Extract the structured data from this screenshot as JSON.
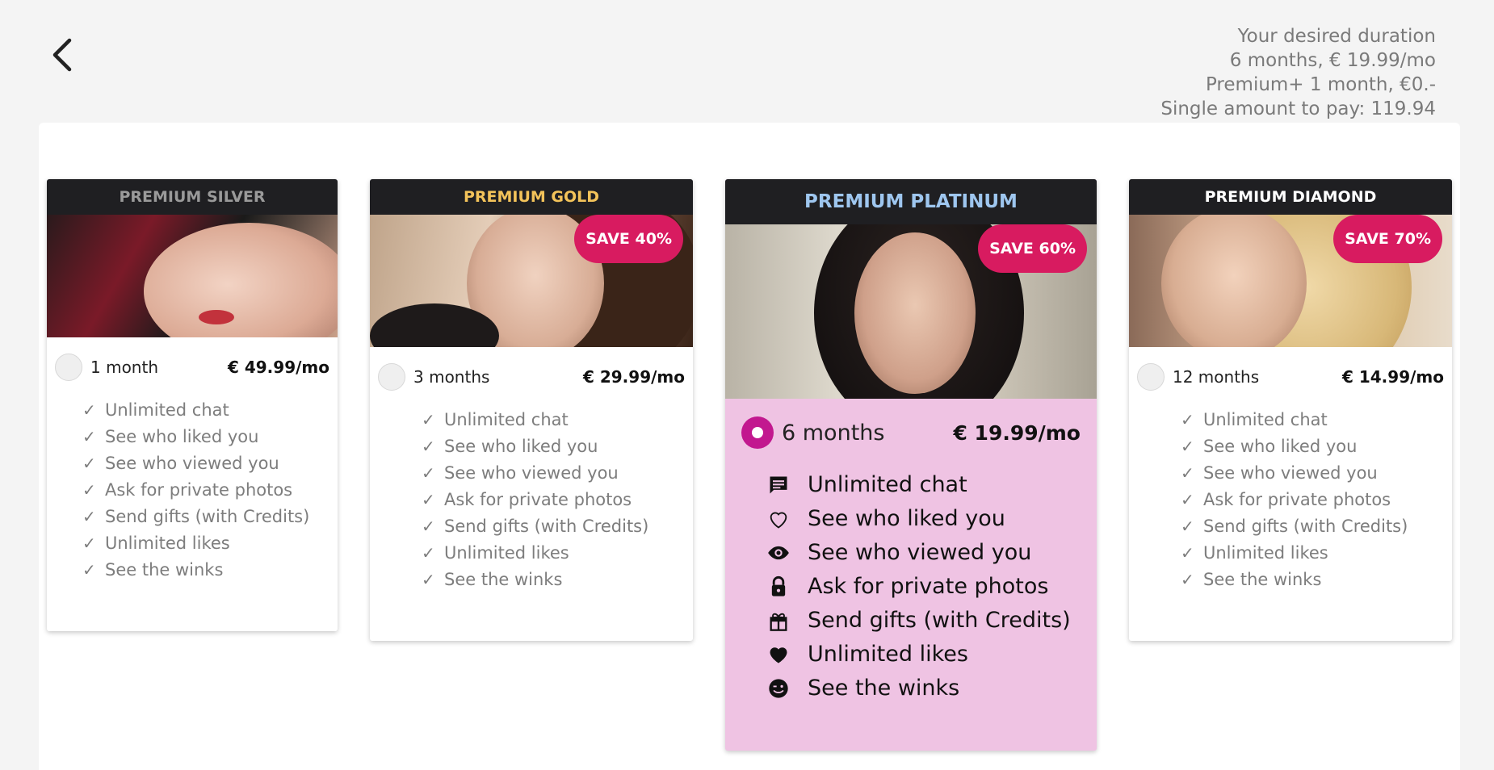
{
  "summary": {
    "line1": "Your desired duration",
    "line2": "6 months, € 19.99/mo",
    "line3": "Premium+ 1 month, €0.-",
    "line4": "Single amount to pay: 119.94"
  },
  "plans": [
    {
      "name": "PREMIUM SILVER",
      "header_color": "#9a9a9a",
      "duration": "1 month",
      "price": "€ 49.99/mo",
      "save": "",
      "selected": false
    },
    {
      "name": "PREMIUM GOLD",
      "header_color": "#f3c35a",
      "duration": "3 months",
      "price": "€ 29.99/mo",
      "save": "SAVE 40%",
      "selected": false
    },
    {
      "name": "PREMIUM PLATINUM",
      "header_color": "#9ec6ef",
      "duration": "6 months",
      "price": "€ 19.99/mo",
      "save": "SAVE 60%",
      "selected": true
    },
    {
      "name": "PREMIUM DIAMOND",
      "header_color": "#ffffff",
      "duration": "12 months",
      "price": "€ 14.99/mo",
      "save": "SAVE 70%",
      "selected": false
    }
  ],
  "features": [
    {
      "label": "Unlimited chat",
      "icon": "chat-icon"
    },
    {
      "label": "See who liked you",
      "icon": "heart-outline-icon"
    },
    {
      "label": "See who viewed you",
      "icon": "eye-icon"
    },
    {
      "label": "Ask for private photos",
      "icon": "lock-icon"
    },
    {
      "label": "Send gifts (with Credits)",
      "icon": "gift-icon"
    },
    {
      "label": "Unlimited likes",
      "icon": "heart-icon"
    },
    {
      "label": "See the winks",
      "icon": "wink-icon"
    }
  ],
  "colors": {
    "accent": "#d81b60",
    "selected_bg": "#efc3e3",
    "radio_selected": "#c2188f",
    "header_bg": "#1f1f22"
  }
}
